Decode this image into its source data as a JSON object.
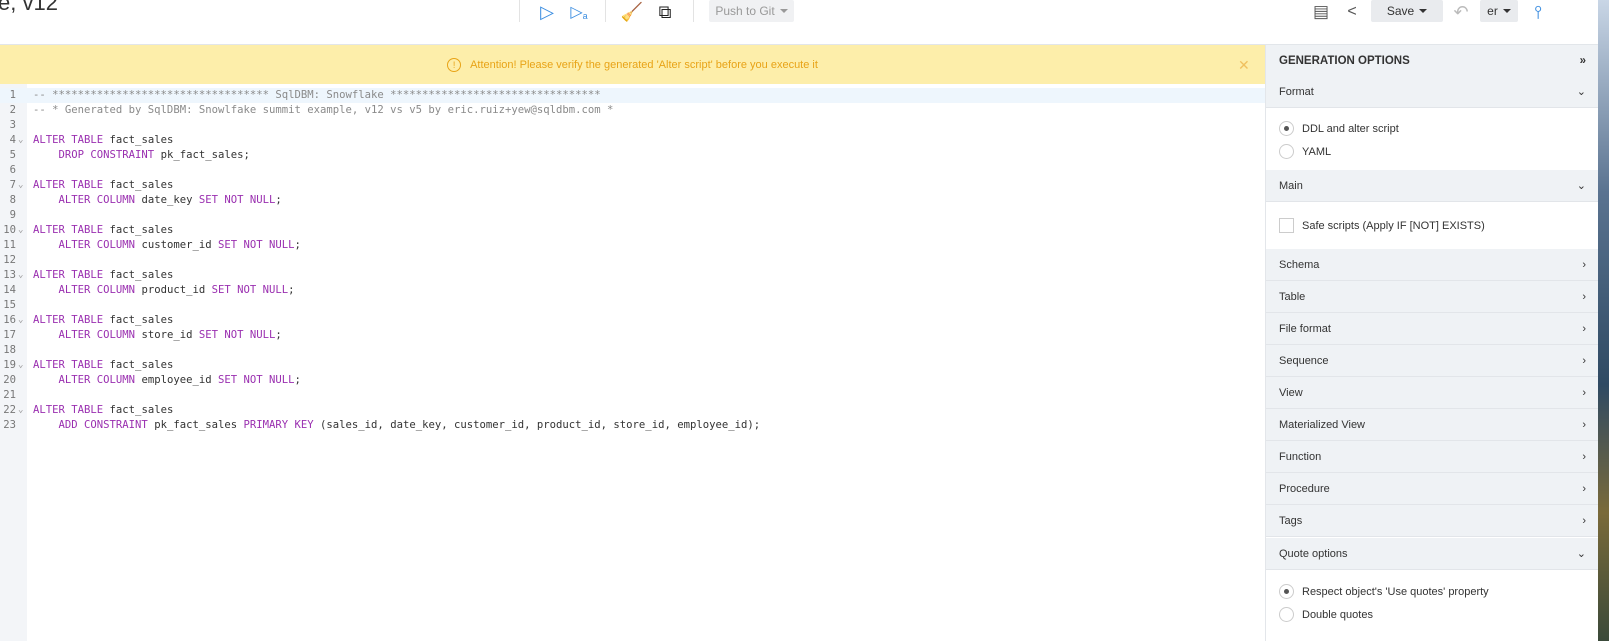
{
  "header": {
    "title": "e, v12",
    "push_label": "Push to Git",
    "save_label": "Save",
    "user_label": "er"
  },
  "banner": {
    "message": "Attention! Please verify the generated 'Alter script' before you execute it"
  },
  "code_lines": [
    [
      [
        "-- ********************************** SqlDBM: Snowflake *********************************",
        "cm"
      ]
    ],
    [
      [
        "-- * Generated by SqlDBM: Snowlfake summit example, v12 vs v5 by eric.ruiz+yew@sqldbm.com *",
        "cm"
      ]
    ],
    [],
    [
      [
        "ALTER TABLE",
        "kw"
      ],
      [
        " fact_sales",
        ""
      ]
    ],
    [
      [
        "    DROP CONSTRAINT",
        "kw"
      ],
      [
        " pk_fact_sales;",
        ""
      ]
    ],
    [],
    [
      [
        "ALTER TABLE",
        "kw"
      ],
      [
        " fact_sales",
        ""
      ]
    ],
    [
      [
        "    ALTER COLUMN",
        "kw"
      ],
      [
        " date_key ",
        ""
      ],
      [
        "SET NOT NULL",
        "kw"
      ],
      [
        ";",
        ""
      ]
    ],
    [],
    [
      [
        "ALTER TABLE",
        "kw"
      ],
      [
        " fact_sales",
        ""
      ]
    ],
    [
      [
        "    ALTER COLUMN",
        "kw"
      ],
      [
        " customer_id ",
        ""
      ],
      [
        "SET NOT NULL",
        "kw"
      ],
      [
        ";",
        ""
      ]
    ],
    [],
    [
      [
        "ALTER TABLE",
        "kw"
      ],
      [
        " fact_sales",
        ""
      ]
    ],
    [
      [
        "    ALTER COLUMN",
        "kw"
      ],
      [
        " product_id ",
        ""
      ],
      [
        "SET NOT NULL",
        "kw"
      ],
      [
        ";",
        ""
      ]
    ],
    [],
    [
      [
        "ALTER TABLE",
        "kw"
      ],
      [
        " fact_sales",
        ""
      ]
    ],
    [
      [
        "    ALTER COLUMN",
        "kw"
      ],
      [
        " store_id ",
        ""
      ],
      [
        "SET NOT NULL",
        "kw"
      ],
      [
        ";",
        ""
      ]
    ],
    [],
    [
      [
        "ALTER TABLE",
        "kw"
      ],
      [
        " fact_sales",
        ""
      ]
    ],
    [
      [
        "    ALTER COLUMN",
        "kw"
      ],
      [
        " employee_id ",
        ""
      ],
      [
        "SET NOT NULL",
        "kw"
      ],
      [
        ";",
        ""
      ]
    ],
    [],
    [
      [
        "ALTER TABLE",
        "kw"
      ],
      [
        " fact_sales",
        ""
      ]
    ],
    [
      [
        "    ADD CONSTRAINT",
        "kw"
      ],
      [
        " pk_fact_sales ",
        ""
      ],
      [
        "PRIMARY KEY",
        "kw"
      ],
      [
        " (sales_id, date_key, customer_id, product_id, store_id, employee_id);",
        ""
      ]
    ]
  ],
  "fold_lines": [
    4,
    7,
    10,
    13,
    16,
    19,
    22
  ],
  "panel": {
    "title": "GENERATION OPTIONS",
    "format": {
      "label": "Format",
      "options": [
        {
          "label": "DDL and alter script",
          "selected": true
        },
        {
          "label": "YAML",
          "selected": false
        }
      ]
    },
    "main": {
      "label": "Main",
      "safe_scripts": {
        "label": "Safe scripts (Apply IF [NOT] EXISTS)",
        "checked": false
      }
    },
    "sections": [
      "Schema",
      "Table",
      "File format",
      "Sequence",
      "View",
      "Materialized View",
      "Function",
      "Procedure",
      "Tags"
    ],
    "quote": {
      "label": "Quote options",
      "options": [
        {
          "label": "Respect object's 'Use quotes' property",
          "selected": true
        },
        {
          "label": "Double quotes",
          "selected": false
        }
      ]
    }
  }
}
